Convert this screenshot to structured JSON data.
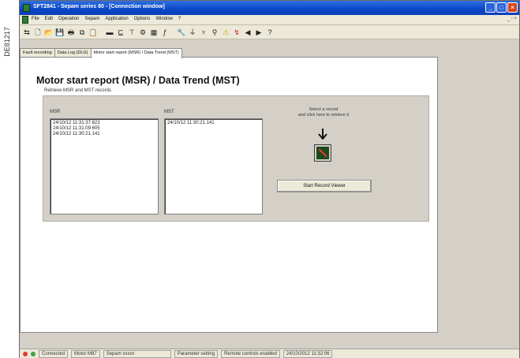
{
  "doc_ref": "DE81217",
  "window": {
    "title": "SFT2841 - Sepam series 80 - [Connection window]"
  },
  "menu": {
    "items": [
      "File",
      "Edit",
      "Operation",
      "Sepam",
      "Application",
      "Options",
      "Window",
      "?"
    ]
  },
  "tabs": [
    {
      "label": "Fault recording"
    },
    {
      "label": "Data Log (DLG)"
    },
    {
      "label": "Motor start report (MSR) / Data Trend (MST)"
    }
  ],
  "panel": {
    "title": "Motor start report (MSR) / Data Trend (MST)",
    "subtitle": "Retrieve MSR and MST records"
  },
  "msr": {
    "label": "MSR",
    "rows": [
      "24/10/12  11:31:37.623",
      "24/10/12  11:31:09.605",
      "24/10/12  11:30:21.141"
    ]
  },
  "mst": {
    "label": "MST",
    "rows": [
      "24/10/12  11:30:21.141"
    ]
  },
  "hint": {
    "line1": "Select a record",
    "line2": "and click here to retrieve it"
  },
  "viewer_button": {
    "label": "Start Record Viewer"
  },
  "status": {
    "connection": "Connected",
    "device": "Motor M87",
    "sepam": "Sepam xxxxx",
    "mode": "Parameter setting",
    "remote": "Remote controls enabled",
    "datetime": "24/10/2012 11:32:06",
    "colors": {
      "red": "#e53935",
      "green": "#43a047"
    }
  }
}
